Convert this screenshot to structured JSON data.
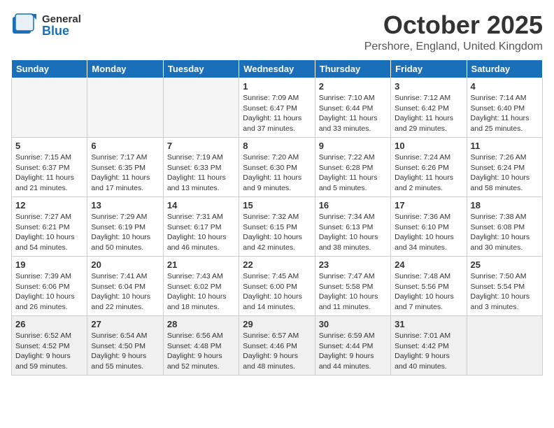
{
  "header": {
    "logo_general": "General",
    "logo_blue": "Blue",
    "month": "October 2025",
    "location": "Pershore, England, United Kingdom"
  },
  "days_of_week": [
    "Sunday",
    "Monday",
    "Tuesday",
    "Wednesday",
    "Thursday",
    "Friday",
    "Saturday"
  ],
  "weeks": [
    [
      {
        "day": "",
        "info": ""
      },
      {
        "day": "",
        "info": ""
      },
      {
        "day": "",
        "info": ""
      },
      {
        "day": "1",
        "info": "Sunrise: 7:09 AM\nSunset: 6:47 PM\nDaylight: 11 hours\nand 37 minutes."
      },
      {
        "day": "2",
        "info": "Sunrise: 7:10 AM\nSunset: 6:44 PM\nDaylight: 11 hours\nand 33 minutes."
      },
      {
        "day": "3",
        "info": "Sunrise: 7:12 AM\nSunset: 6:42 PM\nDaylight: 11 hours\nand 29 minutes."
      },
      {
        "day": "4",
        "info": "Sunrise: 7:14 AM\nSunset: 6:40 PM\nDaylight: 11 hours\nand 25 minutes."
      }
    ],
    [
      {
        "day": "5",
        "info": "Sunrise: 7:15 AM\nSunset: 6:37 PM\nDaylight: 11 hours\nand 21 minutes."
      },
      {
        "day": "6",
        "info": "Sunrise: 7:17 AM\nSunset: 6:35 PM\nDaylight: 11 hours\nand 17 minutes."
      },
      {
        "day": "7",
        "info": "Sunrise: 7:19 AM\nSunset: 6:33 PM\nDaylight: 11 hours\nand 13 minutes."
      },
      {
        "day": "8",
        "info": "Sunrise: 7:20 AM\nSunset: 6:30 PM\nDaylight: 11 hours\nand 9 minutes."
      },
      {
        "day": "9",
        "info": "Sunrise: 7:22 AM\nSunset: 6:28 PM\nDaylight: 11 hours\nand 5 minutes."
      },
      {
        "day": "10",
        "info": "Sunrise: 7:24 AM\nSunset: 6:26 PM\nDaylight: 11 hours\nand 2 minutes."
      },
      {
        "day": "11",
        "info": "Sunrise: 7:26 AM\nSunset: 6:24 PM\nDaylight: 10 hours\nand 58 minutes."
      }
    ],
    [
      {
        "day": "12",
        "info": "Sunrise: 7:27 AM\nSunset: 6:21 PM\nDaylight: 10 hours\nand 54 minutes."
      },
      {
        "day": "13",
        "info": "Sunrise: 7:29 AM\nSunset: 6:19 PM\nDaylight: 10 hours\nand 50 minutes."
      },
      {
        "day": "14",
        "info": "Sunrise: 7:31 AM\nSunset: 6:17 PM\nDaylight: 10 hours\nand 46 minutes."
      },
      {
        "day": "15",
        "info": "Sunrise: 7:32 AM\nSunset: 6:15 PM\nDaylight: 10 hours\nand 42 minutes."
      },
      {
        "day": "16",
        "info": "Sunrise: 7:34 AM\nSunset: 6:13 PM\nDaylight: 10 hours\nand 38 minutes."
      },
      {
        "day": "17",
        "info": "Sunrise: 7:36 AM\nSunset: 6:10 PM\nDaylight: 10 hours\nand 34 minutes."
      },
      {
        "day": "18",
        "info": "Sunrise: 7:38 AM\nSunset: 6:08 PM\nDaylight: 10 hours\nand 30 minutes."
      }
    ],
    [
      {
        "day": "19",
        "info": "Sunrise: 7:39 AM\nSunset: 6:06 PM\nDaylight: 10 hours\nand 26 minutes."
      },
      {
        "day": "20",
        "info": "Sunrise: 7:41 AM\nSunset: 6:04 PM\nDaylight: 10 hours\nand 22 minutes."
      },
      {
        "day": "21",
        "info": "Sunrise: 7:43 AM\nSunset: 6:02 PM\nDaylight: 10 hours\nand 18 minutes."
      },
      {
        "day": "22",
        "info": "Sunrise: 7:45 AM\nSunset: 6:00 PM\nDaylight: 10 hours\nand 14 minutes."
      },
      {
        "day": "23",
        "info": "Sunrise: 7:47 AM\nSunset: 5:58 PM\nDaylight: 10 hours\nand 11 minutes."
      },
      {
        "day": "24",
        "info": "Sunrise: 7:48 AM\nSunset: 5:56 PM\nDaylight: 10 hours\nand 7 minutes."
      },
      {
        "day": "25",
        "info": "Sunrise: 7:50 AM\nSunset: 5:54 PM\nDaylight: 10 hours\nand 3 minutes."
      }
    ],
    [
      {
        "day": "26",
        "info": "Sunrise: 6:52 AM\nSunset: 4:52 PM\nDaylight: 9 hours\nand 59 minutes."
      },
      {
        "day": "27",
        "info": "Sunrise: 6:54 AM\nSunset: 4:50 PM\nDaylight: 9 hours\nand 55 minutes."
      },
      {
        "day": "28",
        "info": "Sunrise: 6:56 AM\nSunset: 4:48 PM\nDaylight: 9 hours\nand 52 minutes."
      },
      {
        "day": "29",
        "info": "Sunrise: 6:57 AM\nSunset: 4:46 PM\nDaylight: 9 hours\nand 48 minutes."
      },
      {
        "day": "30",
        "info": "Sunrise: 6:59 AM\nSunset: 4:44 PM\nDaylight: 9 hours\nand 44 minutes."
      },
      {
        "day": "31",
        "info": "Sunrise: 7:01 AM\nSunset: 4:42 PM\nDaylight: 9 hours\nand 40 minutes."
      },
      {
        "day": "",
        "info": ""
      }
    ]
  ]
}
